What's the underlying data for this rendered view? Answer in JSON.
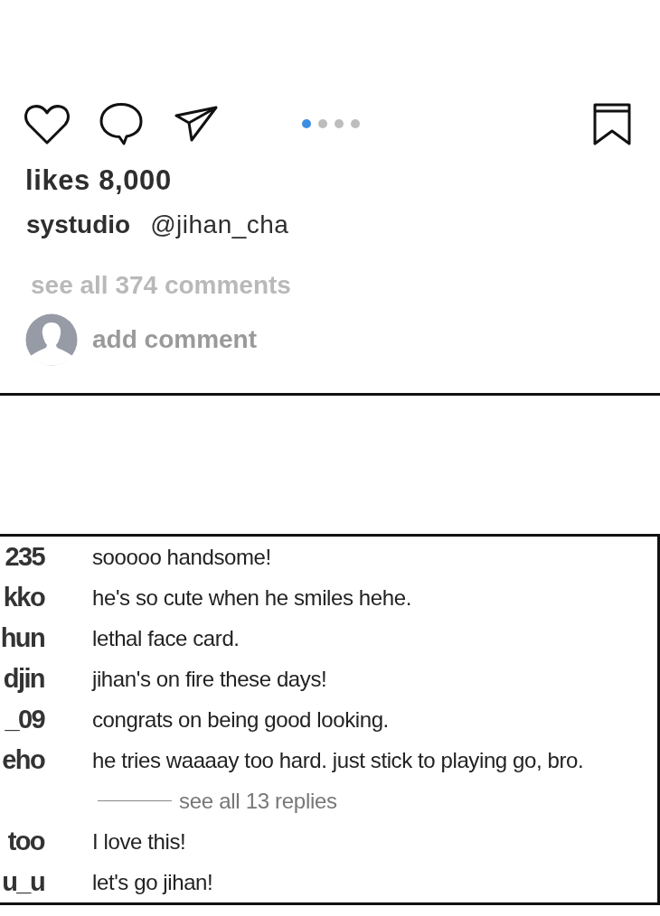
{
  "post_actions": {
    "carousel_dots": [
      {
        "selected": true
      },
      {
        "selected": false
      },
      {
        "selected": false
      },
      {
        "selected": false
      }
    ]
  },
  "likes": "likes 8,000",
  "caption": {
    "username": "systudio",
    "mention": "@jihan_cha"
  },
  "view_comments_link": "see all 374 comments",
  "comment_input": {
    "placeholder": "add comment"
  },
  "comments_panel": {
    "rows": [
      {
        "kind": "comment",
        "username": "235",
        "text": "sooooo handsome!"
      },
      {
        "kind": "comment",
        "username": "kko",
        "text": "he's so cute when he smiles hehe."
      },
      {
        "kind": "comment",
        "username": "hun",
        "text": "lethal face card."
      },
      {
        "kind": "comment",
        "username": "djin",
        "text": "jihan's on fire these days!"
      },
      {
        "kind": "comment",
        "username": "_09",
        "text": "congrats on being good looking."
      },
      {
        "kind": "comment",
        "username": "eho",
        "text": "he tries waaaay too hard. just stick to playing go, bro."
      },
      {
        "kind": "replies",
        "text": "see all 13 replies"
      },
      {
        "kind": "comment",
        "username": "too",
        "text": "I love this!"
      },
      {
        "kind": "comment",
        "username": "u_u",
        "text": "let's go jihan!"
      }
    ]
  }
}
